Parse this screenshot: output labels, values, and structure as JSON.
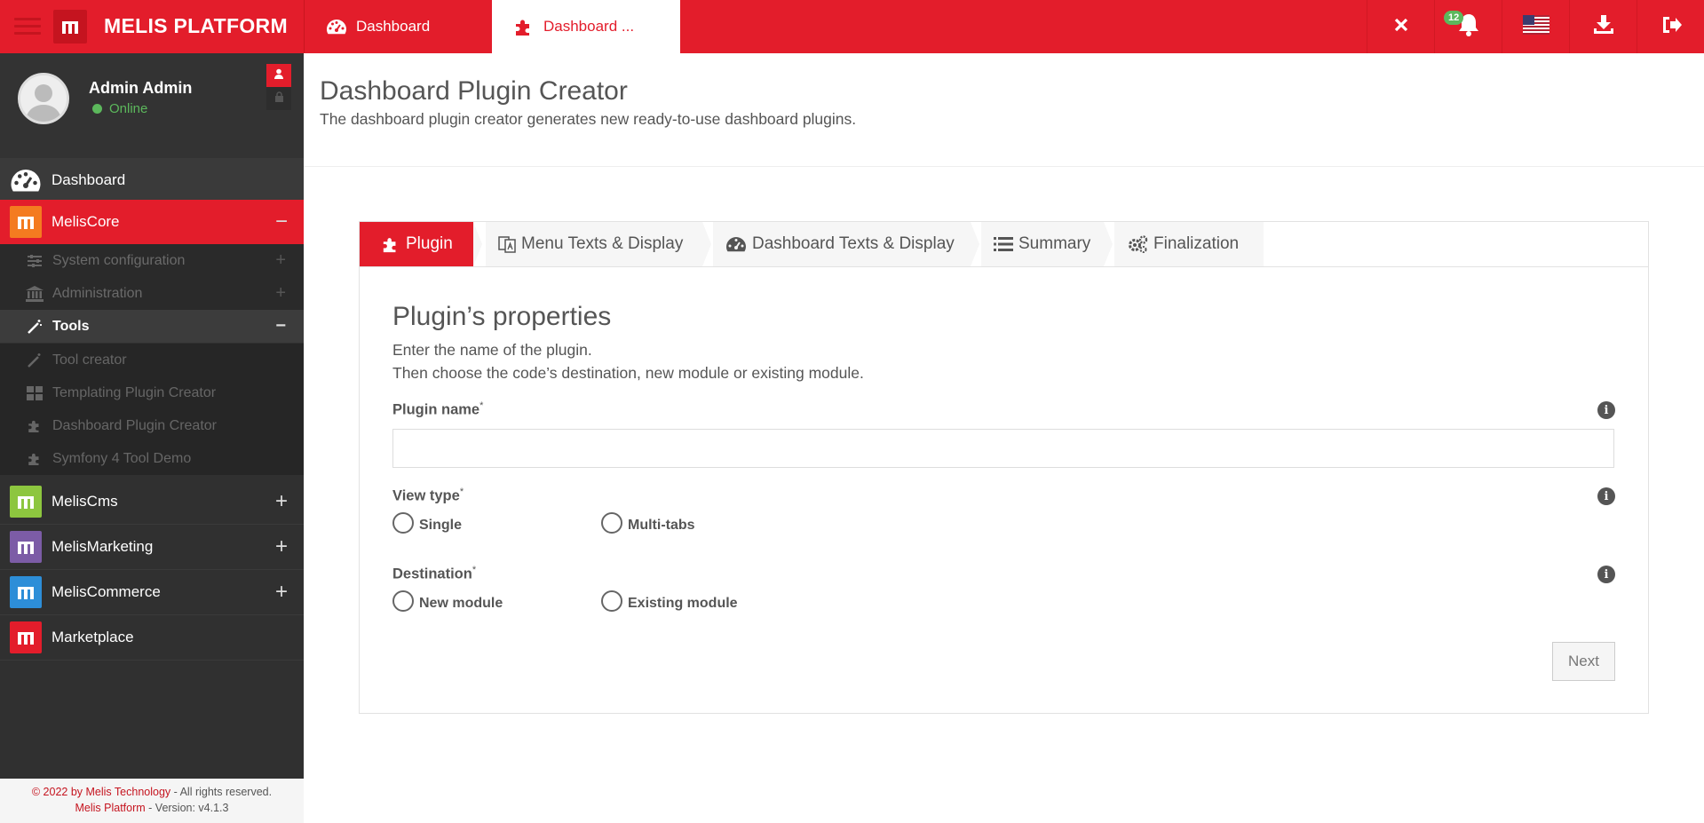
{
  "brand": "MELIS PLATFORM",
  "tabs": [
    {
      "label": "Dashboard",
      "icon": "dashboard-icon"
    },
    {
      "label": "Dashboard ...",
      "icon": "puzzle-icon"
    }
  ],
  "notifications": {
    "count": "12"
  },
  "profile": {
    "name": "Admin Admin",
    "status": "Online"
  },
  "sidebar": {
    "dashboard": "Dashboard",
    "melis_core": "MelisCore",
    "core_children": {
      "system_configuration": "System configuration",
      "administration": "Administration",
      "tools": "Tools",
      "tools_children": {
        "tool_creator": "Tool creator",
        "templating_plugin_creator": "Templating Plugin Creator",
        "dashboard_plugin_creator": "Dashboard Plugin Creator",
        "symfony_tool_demo": "Symfony 4 Tool Demo"
      }
    },
    "melis_cms": "MelisCms",
    "melis_marketing": "MelisMarketing",
    "melis_commerce": "MelisCommerce",
    "marketplace": "Marketplace",
    "module_colors": {
      "core": "#f47b20",
      "cms": "#8dc63f",
      "marketing": "#7c5ca6",
      "commerce": "#2d8ed8",
      "marketplace": "#e31d2b"
    }
  },
  "footer": {
    "copyright_prefix": "© 2022 by ",
    "company": "Melis Technology",
    "rights": " - All rights reserved.",
    "platform": "Melis Platform",
    "version": " - Version: v4.1.3"
  },
  "page": {
    "title": "Dashboard Plugin Creator",
    "subtitle": "The dashboard plugin creator generates new ready-to-use dashboard plugins."
  },
  "wizard": {
    "steps": [
      {
        "label": "Plugin",
        "icon": "puzzle-icon"
      },
      {
        "label": "Menu Texts & Display",
        "icon": "translate-icon"
      },
      {
        "label": "Dashboard Texts & Display",
        "icon": "dashboard-icon"
      },
      {
        "label": "Summary",
        "icon": "list-icon"
      },
      {
        "label": "Finalization",
        "icon": "gears-icon"
      }
    ],
    "active_step": 0,
    "form_title": "Plugin’s properties",
    "desc_line1": "Enter the name of the plugin.",
    "desc_line2": "Then choose the code’s destination, new module or existing module.",
    "plugin_name_label": "Plugin name",
    "plugin_name_value": "",
    "view_type_label": "View type",
    "view_type_options": [
      "Single",
      "Multi-tabs"
    ],
    "destination_label": "Destination",
    "destination_options": [
      "New module",
      "Existing module"
    ],
    "required_mark": "*",
    "next_label": "Next"
  },
  "accent_color": "#e31d2b"
}
